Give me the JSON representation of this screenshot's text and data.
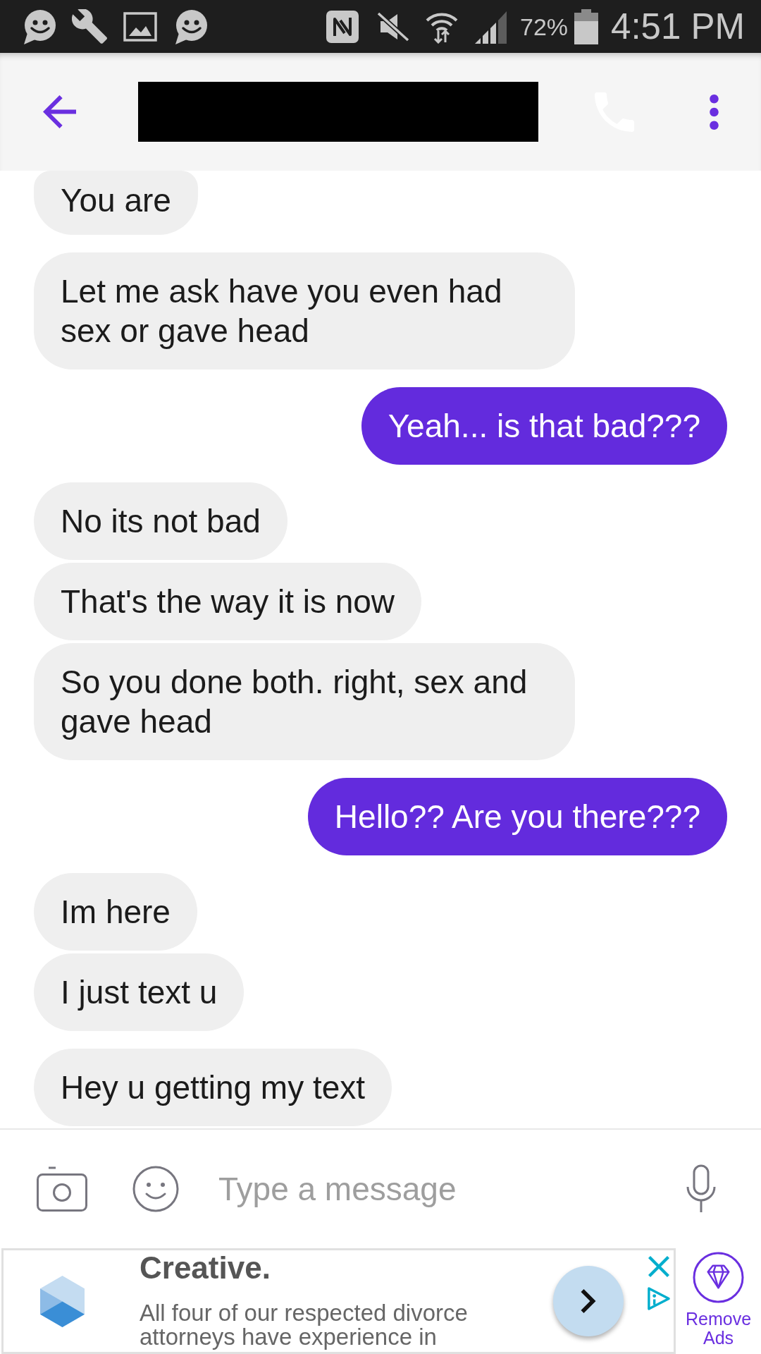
{
  "status_bar": {
    "battery_percent": "72%",
    "time": "4:51 PM"
  },
  "conversation": {
    "groups": [
      {
        "kind": "incoming",
        "messages": [
          "You are"
        ]
      },
      {
        "kind": "incoming",
        "messages": [
          "Let me ask have you even had sex or gave head"
        ]
      },
      {
        "kind": "outgoing",
        "messages": [
          "Yeah... is that bad???"
        ]
      },
      {
        "kind": "incoming",
        "messages": [
          "No its not bad",
          "That's the way it is now",
          "So you done both. right, sex and gave head"
        ]
      },
      {
        "kind": "outgoing",
        "messages": [
          "Hello?? Are you there???"
        ]
      },
      {
        "kind": "incoming",
        "messages": [
          "Im here",
          "I just text u"
        ]
      },
      {
        "kind": "incoming",
        "messages": [
          "Hey u getting my text"
        ]
      }
    ]
  },
  "composer": {
    "placeholder": "Type a message"
  },
  "ad": {
    "title": "Creative.",
    "body": "All four of our respected divorce attorneys have experience in",
    "remove_ads": "Remove Ads"
  }
}
